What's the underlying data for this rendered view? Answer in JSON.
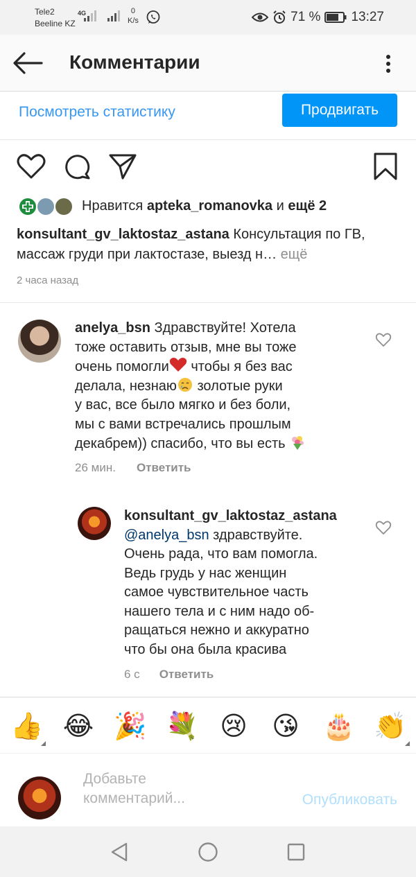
{
  "status_bar": {
    "carrier_1": "Tele2",
    "carrier_2": "Beeline KZ",
    "network": "4G",
    "speed_value": "0",
    "speed_unit": "K/s",
    "battery_text": "71 %",
    "time": "13:27"
  },
  "header": {
    "title": "Комментарии"
  },
  "post": {
    "stats_link": "Посмотреть статистику",
    "promote_button": "Продвигать",
    "likes": {
      "prefix": "Нравится",
      "user": "apteka_romanovka",
      "connector": "и",
      "more": "ещё 2"
    },
    "caption": {
      "username": "konsultant_gv_laktostaz_astana",
      "text": "Консультация по ГВ, массаж груди при лактостазе, выезд н…",
      "more": "ещё"
    },
    "time": "2 часа назад"
  },
  "comments": [
    {
      "username": "anelya_bsn",
      "text_1": "Здравствуйте! Хотела",
      "line_2": "тоже оставить отзыв, мне вы тоже",
      "line_3a": "очень помогли",
      "line_3b": "чтобы я без вас",
      "line_4a": "делала, незнаю",
      "line_4b": "золотые руки",
      "line_5": "у вас, все было мягко и без боли,",
      "line_6": "мы с вами встречались прошлым",
      "line_7": "декабрем)) спасибо, что вы есть",
      "time": "26 мин.",
      "reply": "Ответить"
    },
    {
      "username": "konsultant_gv_laktostaz_astana",
      "mention": "@anelya_bsn",
      "line_1": "здравствуйте.",
      "line_2": "Очень рада, что вам помогла.",
      "line_3": "Ведь грудь у нас женщин",
      "line_4": "самое чувствительное часть",
      "line_5": "нашего тела и с ним надо об-",
      "line_6": "ращаться нежно и аккуратно",
      "line_7": "что бы она была красива",
      "time": "6 с",
      "reply": "Ответить"
    }
  ],
  "emoji_bar": {
    "emojis": [
      "👍",
      "😂",
      "🎉",
      "💐",
      "😢",
      "😘",
      "🎂",
      "👏"
    ]
  },
  "composer": {
    "placeholder_1": "Добавьте",
    "placeholder_2": "комментарий...",
    "publish": "Опубликовать"
  },
  "colors": {
    "accent": "#0095f6",
    "link": "#3897f0",
    "mention": "#00376b",
    "muted": "#8e8e8e"
  }
}
